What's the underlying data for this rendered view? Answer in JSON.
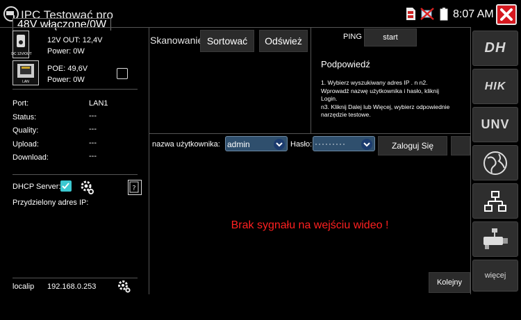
{
  "statusbar": {
    "app_title": "IPC Testować pro",
    "poe_overlay": "48V włączone/0W",
    "time": "8:07 AM"
  },
  "left_panel": {
    "dc_out_label": "12V OUT: 12,4V",
    "dc_power": "Power: 0W",
    "dc_icon_caption": "DC 12V/OUT",
    "poe_label": "POE: 49,6V",
    "poe_power": "Power: 0W",
    "lan_icon_caption": "LAN",
    "port_label": "Port:",
    "port_value": "LAN1",
    "status_label": "Status:",
    "status_value": "---",
    "quality_label": "Quality:",
    "quality_value": "---",
    "upload_label": "Upload:",
    "upload_value": "---",
    "download_label": "Download:",
    "download_value": "---",
    "dhcp_label": "DHCP Server:",
    "assigned_ip_label": "Przydzielony adres IP:",
    "localip_label": "localip",
    "localip_value": "192.168.0.253"
  },
  "scan": {
    "title_behind": "Skanowanie IP",
    "sort_button": "Sortować",
    "refresh_button": "Odśwież"
  },
  "ping": {
    "label": "PING",
    "start_button": "start"
  },
  "hints": {
    "title": "Podpowiedź",
    "line1": "1. Wybierz wyszukiwany adres IP . n n2.",
    "line2": "Wprowadź nazwę użytkownika i hasło, kliknij",
    "line3": "Login.",
    "line4": " n3. Kliknij Dalej lub Więcej, wybierz odpowiednie",
    "line5": "narzędzie testowe."
  },
  "login": {
    "username_label": "nazwa użytkownika:",
    "username_value": "admin",
    "password_label": "Hasło:",
    "password_value": "·········",
    "login_button": "Zaloguj Się"
  },
  "video": {
    "no_signal": "Brak sygnału na wejściu wideo !",
    "next_button": "Kolejny"
  },
  "brands": {
    "dh": "DH",
    "hik": "HIK",
    "unv": "UNV",
    "more": "więcej"
  },
  "colors": {
    "accent_red": "#ff2020",
    "checkbox_on": "#3cc8d0",
    "select_bg": "#2f4f6d",
    "close_red": "#d6181f"
  }
}
